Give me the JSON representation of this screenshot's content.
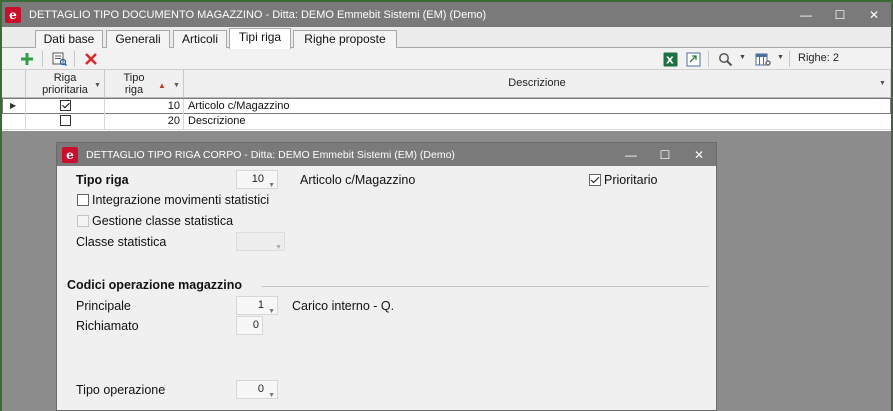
{
  "window": {
    "title": "DETTAGLIO TIPO DOCUMENTO MAGAZZINO - Ditta: DEMO Emmebit Sistemi (EM)  (Demo)",
    "minimize": "—",
    "maximize": "☐",
    "close": "✕"
  },
  "tabs": [
    "Dati base",
    "Generali",
    "Articoli",
    "Tipi riga",
    "Righe proposte"
  ],
  "toolbar": {
    "righe_label": "Righe: 2"
  },
  "grid": {
    "columns": {
      "riga_prioritaria": "Riga prioritaria",
      "tipo_riga": "Tipo riga",
      "descrizione": "Descrizione"
    },
    "rows": [
      {
        "prioritaria": true,
        "tipo_riga": "10",
        "descrizione": "Articolo c/Magazzino"
      },
      {
        "prioritaria": false,
        "tipo_riga": "20",
        "descrizione": "Descrizione"
      }
    ]
  },
  "dialog": {
    "title": "DETTAGLIO TIPO RIGA CORPO - Ditta: DEMO Emmebit Sistemi (EM)  (Demo)",
    "minimize": "—",
    "maximize": "☐",
    "close": "✕",
    "tipo_riga_label": "Tipo riga",
    "tipo_riga_value": "10",
    "tipo_riga_desc": "Articolo c/Magazzino",
    "prioritario_label": "Prioritario",
    "prioritario_checked": true,
    "integrazione_label": "Integrazione movimenti statistici",
    "gestione_label": "Gestione classe statistica",
    "classe_label": "Classe statistica",
    "classe_value": "",
    "codici_header": "Codici operazione magazzino",
    "principale_label": "Principale",
    "principale_value": "1",
    "principale_desc": "Carico interno - Q.",
    "richiamato_label": "Richiamato",
    "richiamato_value": "0",
    "tipo_operazione_label": "Tipo operazione",
    "tipo_operazione_value": "0"
  },
  "colors": {
    "titlebar": "#7a7a7a",
    "frame_border": "#3b6b35",
    "logo_red": "#c8102e",
    "add_icon_green": "#2f9e44",
    "delete_icon_red": "#d62b2b",
    "excel_green": "#1e7145",
    "sort_arrow_red": "#c0392b"
  }
}
